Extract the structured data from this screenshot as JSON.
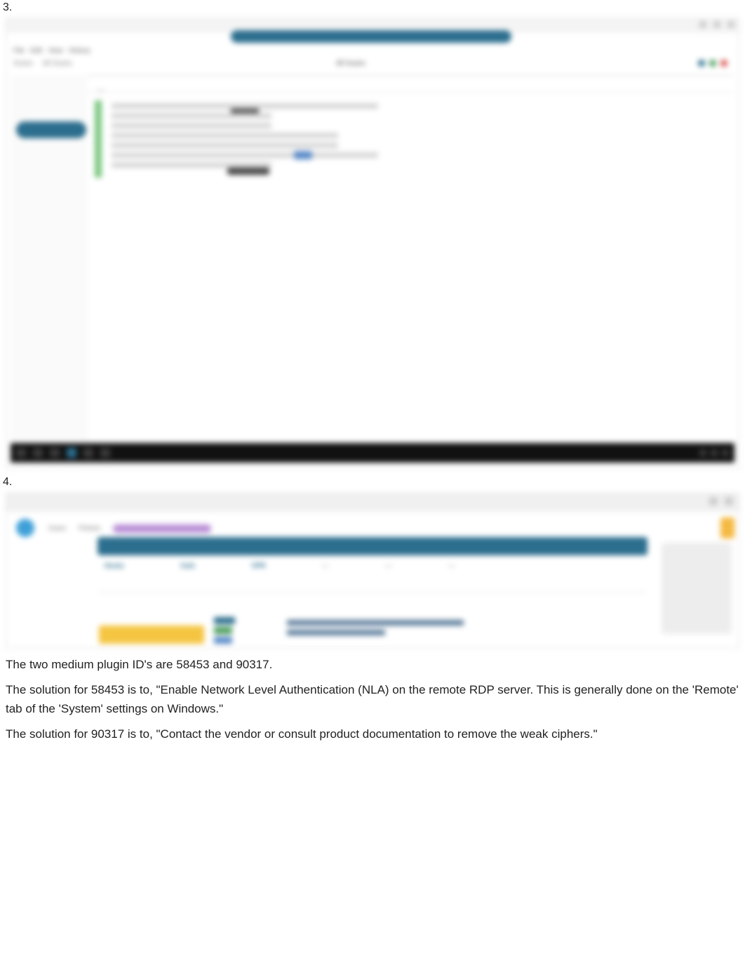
{
  "steps": {
    "three": "3.",
    "four": "4."
  },
  "shot1": {
    "menu": [
      "File",
      "Edit",
      "View",
      "History"
    ],
    "sub": [
      "Scans",
      "All Scans"
    ],
    "page_title": "All Scans",
    "tabs": {
      "active": "Hosts",
      "inactive": "History"
    },
    "headers_line": "—"
  },
  "shot2": {
    "nav": [
      "Scans",
      "",
      "Policies",
      "",
      ""
    ],
    "stats": {
      "c1": "Hosts",
      "c2": "Vuln",
      "c3": "VPR",
      "c4": "—",
      "c5": "—",
      "c6": "—"
    }
  },
  "text": {
    "p1": "The two medium plugin ID's are 58453 and 90317.",
    "p2": "The solution for 58453 is to, \"Enable Network Level Authentication (NLA) on the remote RDP server. This is generally done on the 'Remote' tab of the 'System' settings on Windows.\"",
    "p3": "The solution for 90317 is to, \"Contact the vendor or consult product documentation to remove the weak ciphers.\""
  }
}
